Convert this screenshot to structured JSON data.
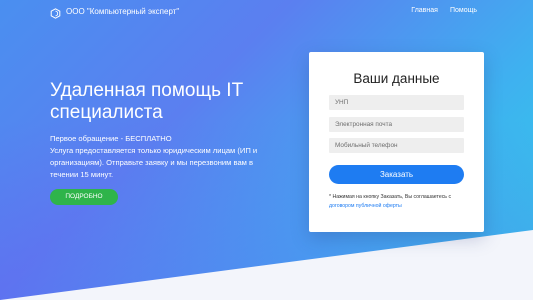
{
  "header": {
    "company_name": "ООО \"Компьютерный эксперт\"",
    "logo_icon": "hexagon-logo-icon",
    "nav": [
      {
        "label": "Главная"
      },
      {
        "label": "Помощь"
      }
    ]
  },
  "hero": {
    "title": "Удаленная помощь IT специалиста",
    "line1": "Первое обращение - БЕСПЛАТНО",
    "line2": "Услуга предоставляется только юридическим лицам (ИП и организациям). Отправьте заявку и мы перезвоним вам в течении 15 минут.",
    "more_button": "ПОДРОБНО"
  },
  "form": {
    "title": "Ваши данные",
    "unp_placeholder": "УНП",
    "email_placeholder": "Электронная почта",
    "phone_placeholder": "Мобильный телефон",
    "submit_label": "Заказать",
    "consent_text": "* Нажимая на кнопку Заказать, Вы соглашаетесь с",
    "consent_link": "договором публичной оферты"
  },
  "colors": {
    "primary_button": "#1e7cf2",
    "more_button": "#2fb44a",
    "gradient_start": "#4a8ff0",
    "gradient_end": "#2fcfe8"
  }
}
